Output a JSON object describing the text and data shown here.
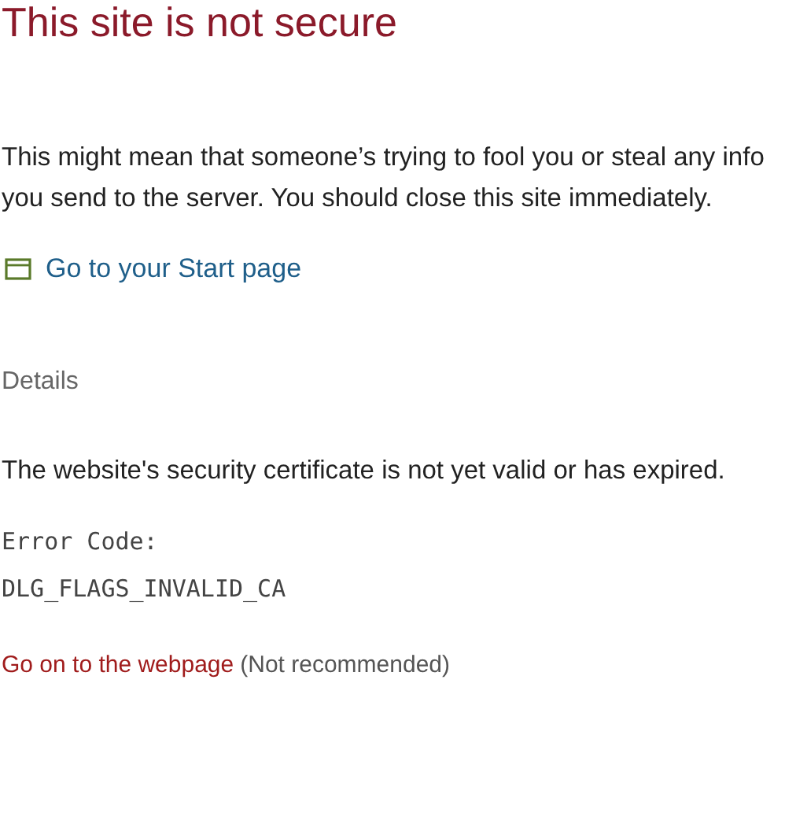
{
  "title": "This site is not secure",
  "message": "This might mean that someone’s trying to fool you or steal any info you send to the server. You should close this site immediately.",
  "start_link": {
    "label": "Go to your Start page"
  },
  "details": {
    "heading": "Details",
    "description": "The website's security certificate is not yet valid or has expired.",
    "error_code_label": "Error Code:",
    "error_code": "DLG_FLAGS_INVALID_CA"
  },
  "continue_link": {
    "label": "Go on to the webpage",
    "note": "(Not recommended)"
  }
}
